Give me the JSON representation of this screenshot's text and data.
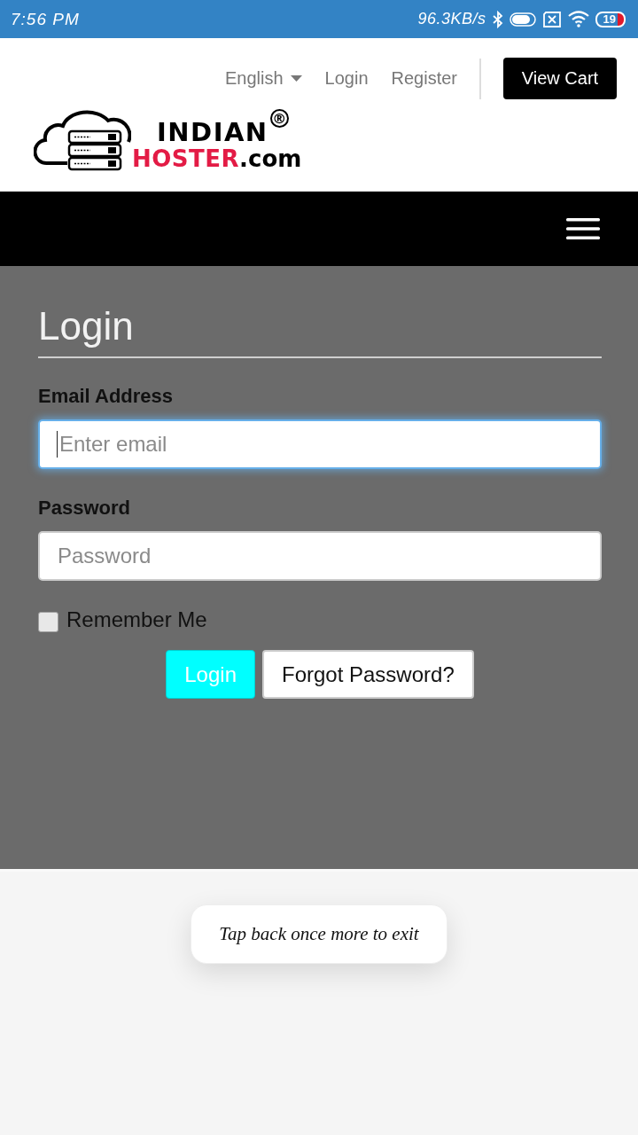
{
  "status_bar": {
    "time": "7:56 PM",
    "speed": "96.3KB/s",
    "battery": "19"
  },
  "header": {
    "language": "English",
    "links": [
      "Login",
      "Register"
    ],
    "cart_button": "View Cart",
    "logo": {
      "line_1": "INDIAN",
      "mark": "®",
      "line_2": "HOSTER",
      "suffix": ".com"
    }
  },
  "form": {
    "title": "Login",
    "fields": [
      {
        "label": "Email Address",
        "placeholder": "Enter email",
        "focused": true
      },
      {
        "label": "Password",
        "placeholder": "Password",
        "focused": false
      }
    ],
    "remember": {
      "label": "Remember Me",
      "checked": false
    },
    "buttons": [
      {
        "label": "Login",
        "kind": "primary"
      },
      {
        "label": "Forgot Password?",
        "kind": "secondary"
      }
    ]
  },
  "toast": {
    "text": "Tap back once more to exit"
  }
}
